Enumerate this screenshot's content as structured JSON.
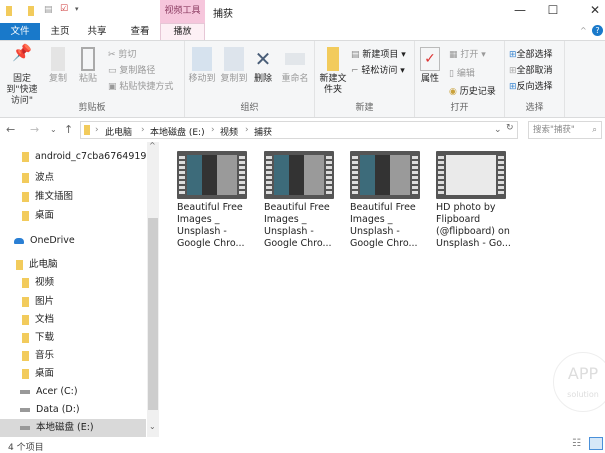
{
  "window": {
    "title": "捕获",
    "context_group": "视频工具",
    "minimize": "—",
    "maximize": "☐",
    "close": "✕"
  },
  "tabs": [
    {
      "label": "文件"
    },
    {
      "label": "主页"
    },
    {
      "label": "共享"
    },
    {
      "label": "查看"
    },
    {
      "label": "播放"
    }
  ],
  "ribbon": {
    "clipboard": {
      "label": "剪贴板",
      "pin": "固定到\"快速访问\"",
      "copy": "复制",
      "paste": "粘贴",
      "cut": "剪切",
      "copy_path": "复制路径",
      "paste_shortcut": "粘贴快捷方式"
    },
    "organize": {
      "label": "组织",
      "move_to": "移动到",
      "copy_to": "复制到",
      "delete": "删除",
      "rename": "重命名"
    },
    "new": {
      "label": "新建",
      "new_folder": "新建文件夹",
      "new_item": "新建项目 ▾",
      "easy_access": "轻松访问 ▾"
    },
    "open": {
      "label": "打开",
      "properties": "属性",
      "open": "打开 ▾",
      "edit": "编辑",
      "history": "历史记录"
    },
    "select": {
      "label": "选择",
      "select_all": "全部选择",
      "select_none": "全部取消",
      "invert": "反向选择"
    }
  },
  "address": {
    "crumbs": [
      "此电脑",
      "本地磁盘 (E:)",
      "视频",
      "捕获"
    ],
    "search_placeholder": "搜索\"捕获\""
  },
  "nav": [
    {
      "label": "android_c7cba6764919c0",
      "icon": "folder-icon"
    },
    {
      "label": "波点",
      "icon": "folder-icon"
    },
    {
      "label": "推文插图",
      "icon": "folder-icon"
    },
    {
      "label": "桌面",
      "icon": "desktop-icon"
    },
    {
      "label": "OneDrive",
      "icon": "cloud-icon"
    },
    {
      "label": "此电脑",
      "icon": "computer-icon"
    },
    {
      "label": "视频",
      "icon": "video-folder-icon"
    },
    {
      "label": "图片",
      "icon": "pictures-folder-icon"
    },
    {
      "label": "文档",
      "icon": "documents-folder-icon"
    },
    {
      "label": "下载",
      "icon": "downloads-folder-icon"
    },
    {
      "label": "音乐",
      "icon": "music-folder-icon"
    },
    {
      "label": "桌面",
      "icon": "desktop-icon"
    },
    {
      "label": "Acer (C:)",
      "icon": "drive-icon"
    },
    {
      "label": "Data (D:)",
      "icon": "drive-icon"
    },
    {
      "label": "本地磁盘 (E:)",
      "icon": "drive-icon",
      "selected": true
    }
  ],
  "files": [
    {
      "name": "Beautiful Free Images _ Unsplash - Google Chro..."
    },
    {
      "name": "Beautiful Free Images _ Unsplash - Google Chro..."
    },
    {
      "name": "Beautiful Free Images _ Unsplash - Google Chro..."
    },
    {
      "name": "HD photo by Flipboard (@flipboard) on Unsplash - Go..."
    }
  ],
  "status": {
    "count": "4 个项目"
  },
  "watermark": "APP solution",
  "colors": {
    "file_tab": "#1979ca",
    "context_tab": "#f6c6dc",
    "selected": "#d9d9d9"
  }
}
